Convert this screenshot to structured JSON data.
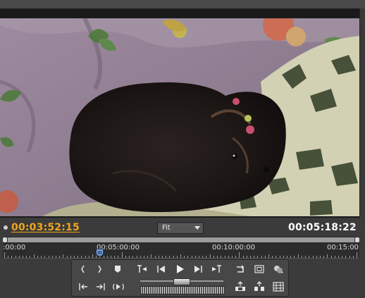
{
  "program_monitor": {
    "current_timecode": "00:03:52:15",
    "duration_timecode": "00:05:18:22",
    "zoom_select": {
      "selected": "Fit"
    },
    "ruler_labels": [
      ":00:00",
      "00:05:00:00",
      "00:10:00:00",
      "00:15:00"
    ],
    "playhead_position_fraction": 0.27
  },
  "icons": {
    "set_in": "mark-in-icon",
    "set_out": "mark-out-icon",
    "set_marker": "marker-icon",
    "goto_in": "go-to-in-icon",
    "step_back": "step-back-icon",
    "play": "play-icon",
    "step_forward": "step-forward-icon",
    "goto_out": "go-to-out-icon",
    "clear_in": "clear-in-icon",
    "clear_out": "clear-out-icon",
    "play_in_to_out": "play-in-to-out-icon",
    "loop": "loop-icon",
    "safe_margins": "safe-margins-icon",
    "output": "output-icon",
    "lift": "lift-icon",
    "extract": "extract-icon",
    "export_frame": "export-frame-icon"
  },
  "colors": {
    "current_timecode": "#f0a61a",
    "playhead": "#6ea2de"
  }
}
